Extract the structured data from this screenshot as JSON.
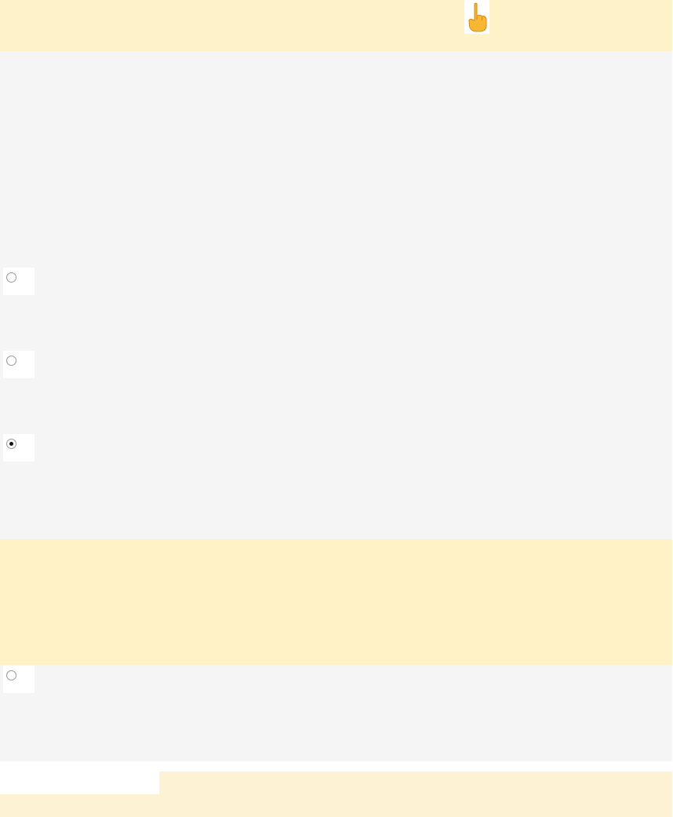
{
  "toolbar": {
    "pointer_icon": "pointing-up-hand-icon"
  },
  "options": [
    {
      "checked": false
    },
    {
      "checked": false
    },
    {
      "checked": true
    },
    {
      "checked": false
    }
  ],
  "colors": {
    "highlight": "#fef3c8",
    "panel": "#f5f5f5",
    "footer": "#fef2d4"
  }
}
